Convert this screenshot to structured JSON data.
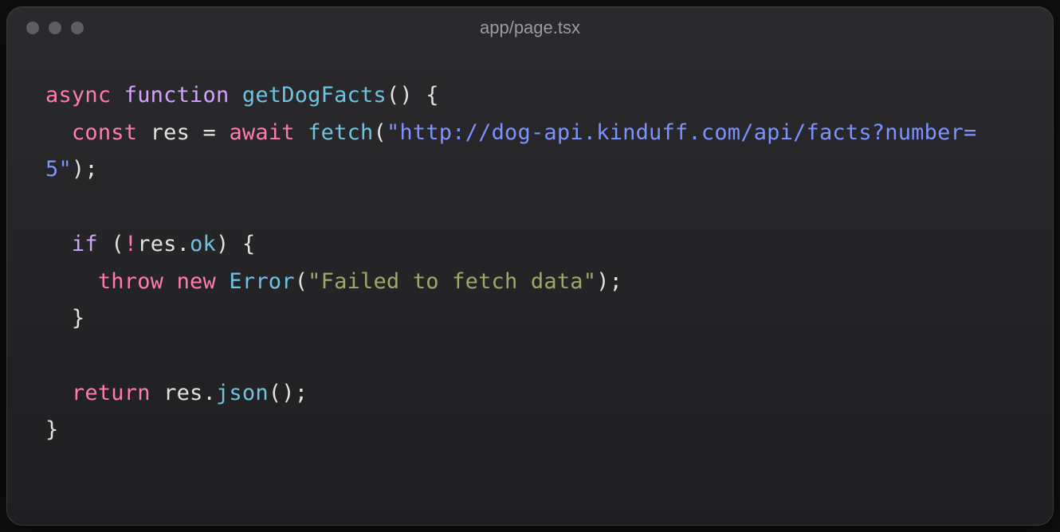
{
  "titlebar": {
    "filename": "app/page.tsx"
  },
  "tokens": {
    "async": "async",
    "function": "function",
    "getDogFacts": "getDogFacts",
    "lparen": "(",
    "rparen": ")",
    "lbrace": "{",
    "rbrace": "}",
    "const": "const",
    "res": "res",
    "eq": "=",
    "await": "await",
    "fetch": "fetch",
    "url": "\"http://dog-api.kinduff.com/api/facts?number=5\"",
    "semi": ";",
    "if": "if",
    "bang": "!",
    "ok": "ok",
    "dot": ".",
    "throw": "throw",
    "new": "new",
    "Error": "Error",
    "errmsg": "\"Failed to fetch data\"",
    "return": "return",
    "json": "json"
  }
}
